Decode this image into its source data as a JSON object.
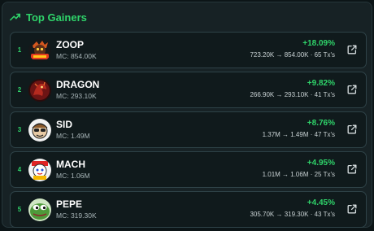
{
  "header": {
    "title": "Top Gainers",
    "icon": "trending-up-icon",
    "accent": "#2fd36a"
  },
  "tokens": [
    {
      "rank": "1",
      "name": "ZOOP",
      "mc": "MC: 854.00K",
      "change": "+18.09%",
      "detail": "723.20K → 854.00K · 65 Tx's",
      "avatar": "zoop-avatar-icon"
    },
    {
      "rank": "2",
      "name": "DRAGON",
      "mc": "MC: 293.10K",
      "change": "+9.82%",
      "detail": "266.90K → 293.10K · 41 Tx's",
      "avatar": "dragon-avatar-icon"
    },
    {
      "rank": "3",
      "name": "SID",
      "mc": "MC: 1.49M",
      "change": "+8.76%",
      "detail": "1.37M → 1.49M · 47 Tx's",
      "avatar": "sid-avatar-icon"
    },
    {
      "rank": "4",
      "name": "MACH",
      "mc": "MC: 1.06M",
      "change": "+4.95%",
      "detail": "1.01M → 1.06M · 25 Tx's",
      "avatar": "mach-avatar-icon"
    },
    {
      "rank": "5",
      "name": "PEPE",
      "mc": "MC: 319.30K",
      "change": "+4.45%",
      "detail": "305.70K → 319.30K · 43 Tx's",
      "avatar": "pepe-avatar-icon"
    }
  ]
}
